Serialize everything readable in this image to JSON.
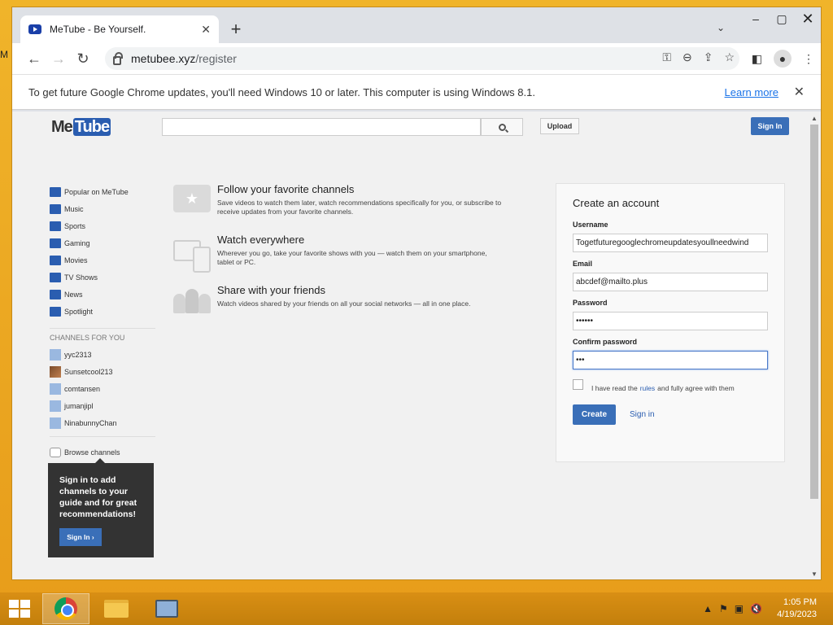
{
  "browser": {
    "tab_title": "MeTube - Be Yourself.",
    "url_host": "metubee.xyz",
    "url_path": "/register",
    "infobar_text": "To get future Google Chrome updates, you'll need Windows 10 or later. This computer is using Windows 8.1.",
    "learn_more": "Learn more"
  },
  "header": {
    "logo_me": "Me",
    "logo_tube": "Tube",
    "search_value": "",
    "upload_label": "Upload",
    "signin_label": "Sign In"
  },
  "guide": {
    "items": [
      "Popular on MeTube",
      "Music",
      "Sports",
      "Gaming",
      "Movies",
      "TV Shows",
      "News",
      "Spotlight"
    ],
    "channels_heading": "CHANNELS FOR YOU",
    "channels": [
      "yyc2313",
      "Sunsetcool213",
      "comtansen",
      "jumanjipl",
      "NinabunnyChan"
    ],
    "browse": "Browse channels",
    "promo_text": "Sign in to add channels to your guide and for great recommendations!",
    "promo_button": "Sign In ›"
  },
  "features": [
    {
      "title": "Follow your favorite channels",
      "desc": "Save videos to watch them later, watch recommendations specifically for you, or subscribe to receive updates from your favorite channels."
    },
    {
      "title": "Watch everywhere",
      "desc": "Wherever you go, take your favorite shows with you — watch them on your smartphone, tablet or PC."
    },
    {
      "title": "Share with your friends",
      "desc": "Watch videos shared by your friends on all your social networks — all in one place."
    }
  ],
  "form": {
    "title": "Create an account",
    "username_label": "Username",
    "username_value": "Togetfuturegooglechromeupdatesyoullneedwind",
    "email_label": "Email",
    "email_value": "abcdef@mailto.plus",
    "password_label": "Password",
    "password_value": "••••••",
    "confirm_label": "Confirm password",
    "confirm_value": "•••",
    "agree_prefix": "I have read the",
    "agree_link": "rules",
    "agree_suffix": "and fully agree with them",
    "create_button": "Create",
    "signin_link": "Sign in"
  },
  "taskbar": {
    "time": "1:05 PM",
    "date": "4/19/2023"
  }
}
